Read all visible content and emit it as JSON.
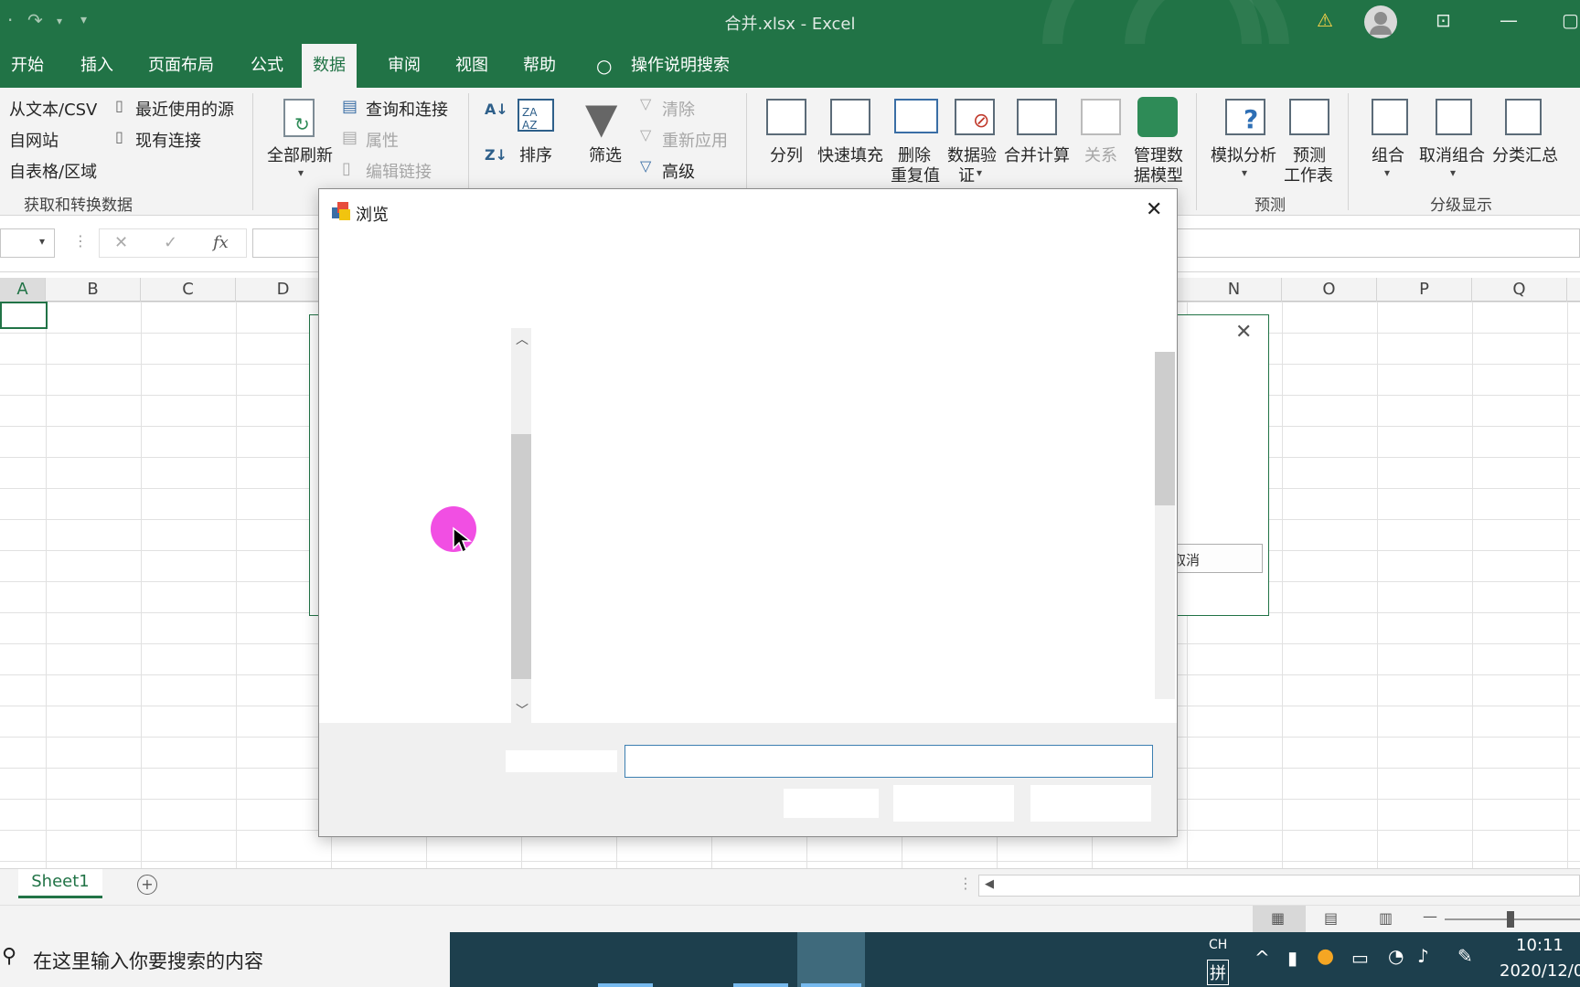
{
  "window": {
    "title": "合并.xlsx - Excel"
  },
  "ribbon_tabs": [
    "开始",
    "插入",
    "页面布局",
    "公式",
    "数据",
    "审阅",
    "视图",
    "帮助",
    "操作说明搜索"
  ],
  "active_tab": "数据",
  "ribbon": {
    "get_transform": {
      "from_text": "从文本/CSV",
      "recent_sources": "最近使用的源",
      "from_web": "自网站",
      "existing_conn": "现有连接",
      "from_table": "自表格/区域",
      "group_label": "获取和转换数据"
    },
    "queries": {
      "refresh_all": "全部刷新",
      "queries_conn": "查询和连接",
      "properties": "属性",
      "edit_links": "编辑链接"
    },
    "sort_filter": {
      "sort": "排序",
      "filter": "筛选",
      "clear": "清除",
      "reapply": "重新应用",
      "advanced": "高级"
    },
    "data_tools": {
      "split": "分列",
      "flash_fill": "快速填充",
      "remove_dup_1": "删除",
      "remove_dup_2": "重复值",
      "validation_1": "数据验",
      "validation_2": "证",
      "consolidate": "合并计算",
      "relations": "关系",
      "manage_model_1": "管理数",
      "manage_model_2": "据模型"
    },
    "forecast": {
      "what_if": "模拟分析",
      "forecast_sheet_1": "预测",
      "forecast_sheet_2": "工作表",
      "group_label": "预测"
    },
    "outline": {
      "group": "组合",
      "ungroup": "取消组合",
      "subtotal": "分类汇总",
      "group_label": "分级显示"
    }
  },
  "formula_bar": {
    "fx": "fx",
    "cancel": "✕",
    "enter": "✓"
  },
  "columns": [
    "A",
    "B",
    "C",
    "D",
    "N",
    "O",
    "P",
    "Q"
  ],
  "browse_dialog": {
    "title": "浏览",
    "close": "✕"
  },
  "behind_dialog": {
    "cancel": "取消",
    "close": "✕"
  },
  "sheet": {
    "name": "Sheet1",
    "add": "+"
  },
  "taskbar": {
    "search_placeholder": "在这里输入你要搜索的内容",
    "ime_lang": "CH",
    "ime_mode": "拼",
    "time": "10:11",
    "date": "2020/12/0"
  }
}
